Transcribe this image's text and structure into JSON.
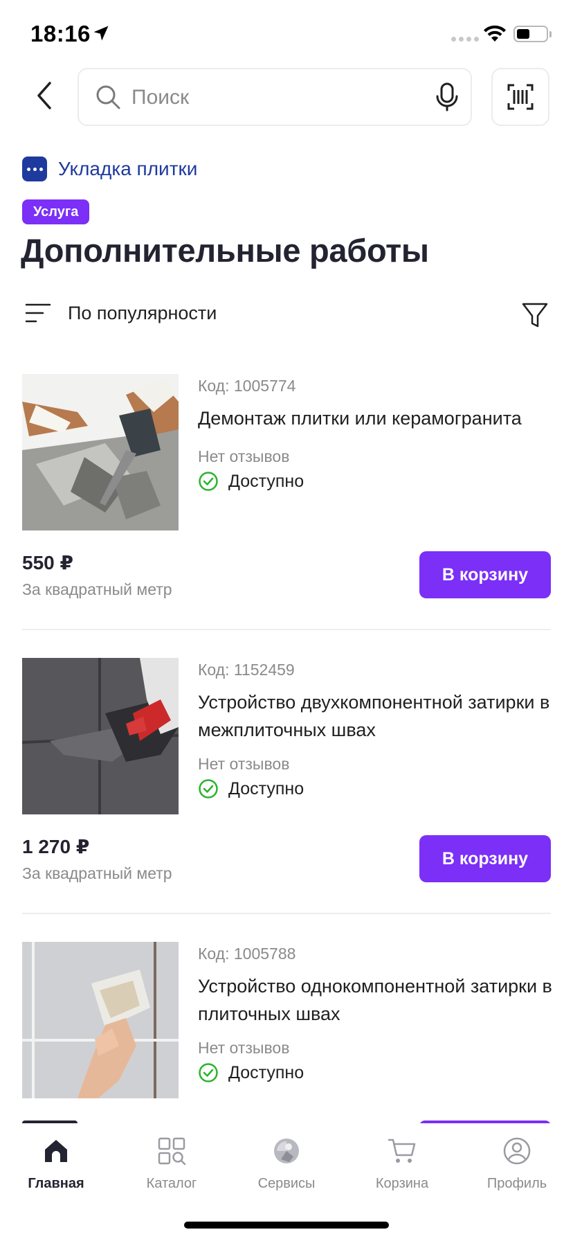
{
  "status_bar": {
    "time": "18:16"
  },
  "header": {
    "search_placeholder": "Поиск"
  },
  "category": {
    "label": "Укладка плитки"
  },
  "badge": {
    "label": "Услуга"
  },
  "page": {
    "title": "Дополнительные работы"
  },
  "sort": {
    "label": "По популярности"
  },
  "colors": {
    "accent": "#7b2ff7",
    "category": "#1e3a9e",
    "available": "#2bb32b"
  },
  "products": [
    {
      "code": "Код: 1005774",
      "name": "Демонтаж плитки или керамогранита",
      "reviews": "Нет отзывов",
      "status": "Доступно",
      "price": "550 ₽",
      "unit": "За квадратный метр",
      "cart_label": "В корзину"
    },
    {
      "code": "Код: 1152459",
      "name": "Устройство двухкомпонентной затирки в межплиточных швах",
      "reviews": "Нет отзывов",
      "status": "Доступно",
      "price": "1 270 ₽",
      "unit": "За квадратный метр",
      "cart_label": "В корзину"
    },
    {
      "code": "Код: 1005788",
      "name": "Устройство однокомпонентной затирки в плиточных швах",
      "reviews": "Нет отзывов",
      "status": "Доступно"
    }
  ],
  "tabs": [
    {
      "label": "Главная",
      "icon": "home-icon",
      "active": true
    },
    {
      "label": "Каталог",
      "icon": "catalog-icon",
      "active": false
    },
    {
      "label": "Сервисы",
      "icon": "services-icon",
      "active": false
    },
    {
      "label": "Корзина",
      "icon": "cart-icon",
      "active": false
    },
    {
      "label": "Профиль",
      "icon": "profile-icon",
      "active": false
    }
  ]
}
